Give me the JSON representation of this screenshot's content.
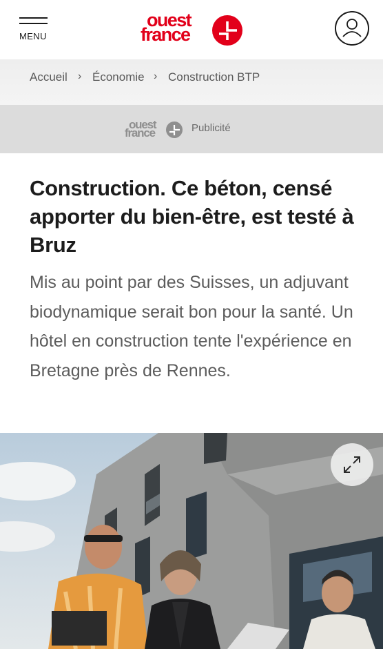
{
  "header": {
    "menu_label": "MENU",
    "logo_line1": "ouest",
    "logo_line2": "france",
    "brand_color": "#e2001a",
    "user_icon": "user-icon"
  },
  "breadcrumb": {
    "items": [
      "Accueil",
      "Économie",
      "Construction BTP"
    ],
    "separator": "›"
  },
  "ad": {
    "logo_line1": "ouest",
    "logo_line2": "france",
    "label": "Publicité"
  },
  "article": {
    "headline": "Construction. Ce béton, censé apporter du bien-être, est testé à Bruz",
    "lead": "Mis au point par des Suisses, un adjuvant biodynamique serait bon pour la santé. Un hôtel en construction tente l'expérience en Bretagne près de Rennes.",
    "expand_icon": "expand-icon"
  }
}
